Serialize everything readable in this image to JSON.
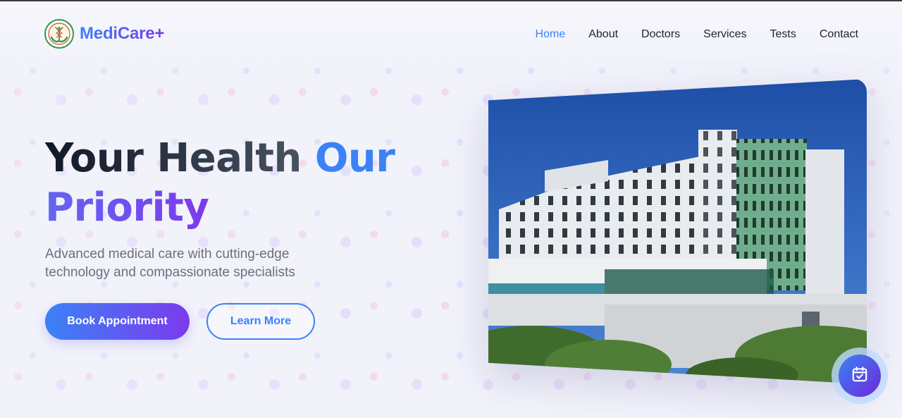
{
  "brand": {
    "name": "MediCare+",
    "logo_icon": "caduceus-hands-icon"
  },
  "nav": {
    "items": [
      {
        "label": "Home",
        "active": true
      },
      {
        "label": "About",
        "active": false
      },
      {
        "label": "Doctors",
        "active": false
      },
      {
        "label": "Services",
        "active": false
      },
      {
        "label": "Tests",
        "active": false
      },
      {
        "label": "Contact",
        "active": false
      }
    ]
  },
  "hero": {
    "title_part1": "Your Health ",
    "title_part2": "Our",
    "title_part3": "Priority",
    "subtitle": "Advanced medical care with cutting-edge technology and compassionate specialists",
    "primary_button": "Book Appointment",
    "secondary_button": "Learn More",
    "image_icon": "hospital-building-photo"
  },
  "floating_action": {
    "icon": "calendar-check-icon"
  },
  "colors": {
    "accent_blue": "#3b82f6",
    "accent_purple": "#7c3aed",
    "background": "#f2f2fb",
    "text_dark": "#1f2230",
    "text_muted": "#6b6f7d"
  }
}
